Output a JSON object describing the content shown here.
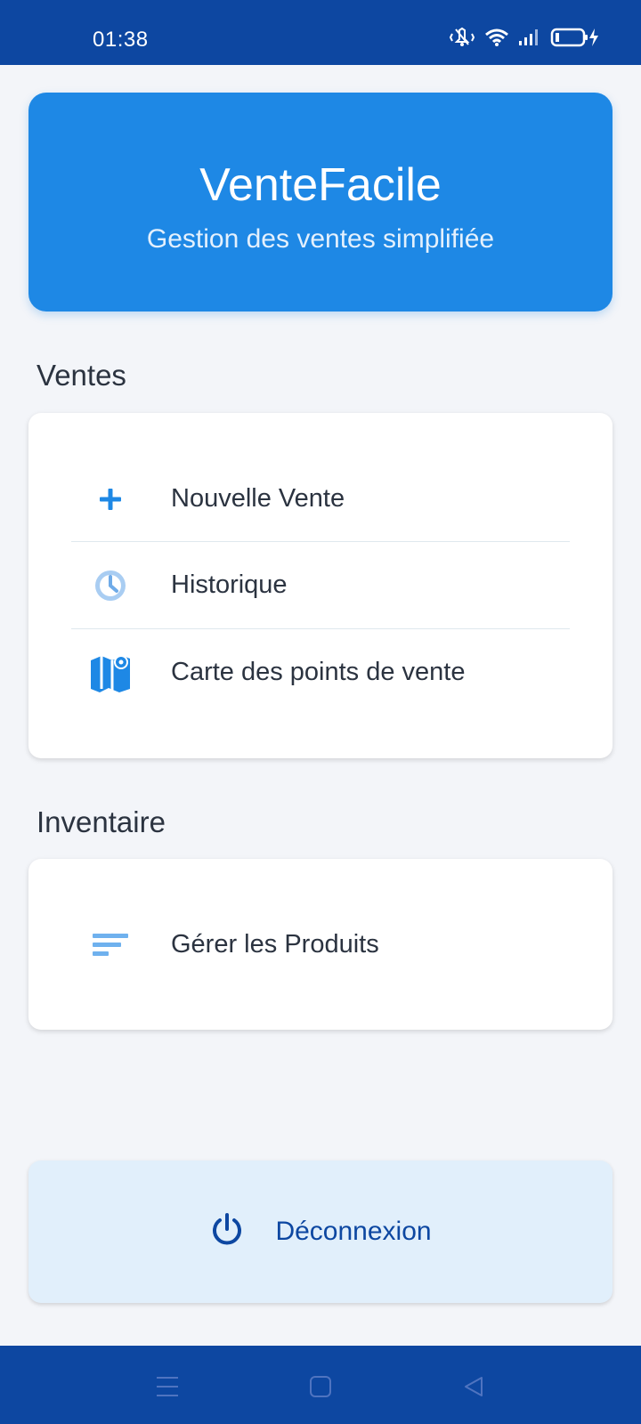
{
  "status_bar": {
    "time": "01:38",
    "icons": [
      "vibrate-icon",
      "wifi-icon",
      "signal-icon",
      "battery-charging-icon"
    ]
  },
  "header": {
    "title": "VenteFacile",
    "subtitle": "Gestion des ventes simplifiée"
  },
  "sections": {
    "sales": {
      "title": "Ventes",
      "items": [
        {
          "label": "Nouvelle Vente",
          "icon": "plus-icon"
        },
        {
          "label": "Historique",
          "icon": "clock-icon"
        },
        {
          "label": "Carte des points de vente",
          "icon": "map-icon"
        }
      ]
    },
    "inventory": {
      "title": "Inventaire",
      "items": [
        {
          "label": "Gérer les Produits",
          "icon": "list-icon"
        }
      ]
    }
  },
  "logout": {
    "label": "Déconnexion",
    "icon": "power-icon"
  },
  "nav_bar": {
    "buttons": [
      "menu-icon",
      "home-icon",
      "back-icon"
    ]
  },
  "colors": {
    "primary": "#1e88e5",
    "dark": "#0d47a1",
    "background": "#f3f5f9",
    "logout_bg": "#e1effb"
  }
}
